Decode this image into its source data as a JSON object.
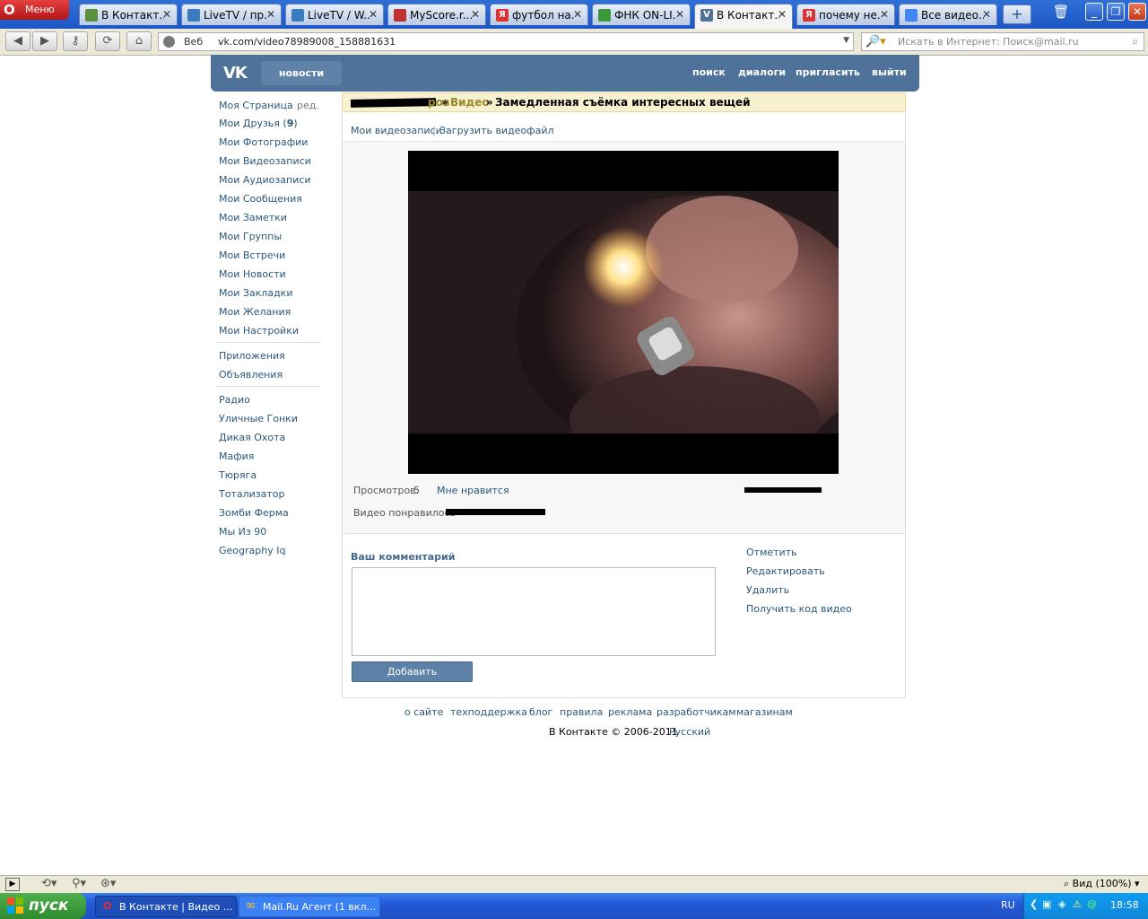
{
  "browser": {
    "menu_label": "Меню",
    "tabs": [
      {
        "label": "В Контакт...",
        "icon": "vk-icon",
        "color": "#5a8f3e"
      },
      {
        "label": "LiveTV / пр...",
        "icon": "page-icon",
        "color": "#3b7bbf"
      },
      {
        "label": "LiveTV / W...",
        "icon": "page-icon",
        "color": "#3b7bbf"
      },
      {
        "label": "MyScore.r...",
        "icon": "myscore-icon",
        "color": "#c03030"
      },
      {
        "label": "футбол на...",
        "icon": "yandex-icon",
        "color": "#e03030"
      },
      {
        "label": "ФНК ON-LI...",
        "icon": "fnk-icon",
        "color": "#3a9a3a"
      },
      {
        "label": "В Контакт...",
        "icon": "vk-icon",
        "color": "#4e729a"
      },
      {
        "label": "почему не...",
        "icon": "yandex-icon",
        "color": "#e03030"
      },
      {
        "label": "Все видео...",
        "icon": "google-icon",
        "color": "#4285f4"
      }
    ],
    "url_prefix": "Веб",
    "url": "vk.com/video78989008_158881631",
    "search_placeholder": "Искать в Интернет: Поиск@mail.ru",
    "zoom_label": "Вид (100%)"
  },
  "vk": {
    "logo": "VK",
    "news_link": "новости",
    "top_links": [
      "поиск",
      "диалоги",
      "пригласить",
      "выйти"
    ],
    "nav": {
      "my_page": "Моя Страница",
      "edit": "ред.",
      "friends": "Мои Друзья",
      "friends_count": "9",
      "group1": [
        "Мои Фотографии",
        "Мои Видеозаписи",
        "Мои Аудиозаписи",
        "Мои Сообщения",
        "Мои Заметки",
        "Мои Группы",
        "Мои Встречи",
        "Мои Новости",
        "Мои Закладки",
        "Мои Желания",
        "Мои Настройки"
      ],
      "group2": [
        "Приложения",
        "Объявления"
      ],
      "group3": [
        "Радио",
        "Уличные Гонки",
        "Дикая Охота",
        "Мафия",
        "Тюряга",
        "Тотализатор",
        "Зомби Ферма",
        "Мы Из 90",
        "Geography Iq"
      ]
    },
    "breadcrumb": {
      "owner": "ров",
      "video": "Видео",
      "title": "Замедленная съёмка интересных вещей"
    },
    "sublinks": {
      "my_videos": "Мои видеозаписи",
      "upload": "Загрузить видеофайл"
    },
    "views_label": "Просмотров:",
    "views_count": "5",
    "like_label": "Мне нравится",
    "liked_by_label": "Видео понравилось",
    "comment_label": "Ваш комментарий",
    "add_comment": "Добавить комментарий",
    "actions": [
      "Отметить",
      "Редактировать",
      "Удалить",
      "Получить код видео"
    ],
    "footer_links": [
      "о сайте",
      "техподдержка",
      "блог",
      "правила",
      "реклама",
      "разработчикам",
      "магазинам"
    ],
    "copyright": "В Контакте © 2006-2011",
    "language": "Русский"
  },
  "taskbar": {
    "start": "пуск",
    "tasks": [
      "В Контакте | Видео ...",
      "Mail.Ru Агент (1 вкл..."
    ],
    "lang": "RU",
    "time": "18:58"
  }
}
